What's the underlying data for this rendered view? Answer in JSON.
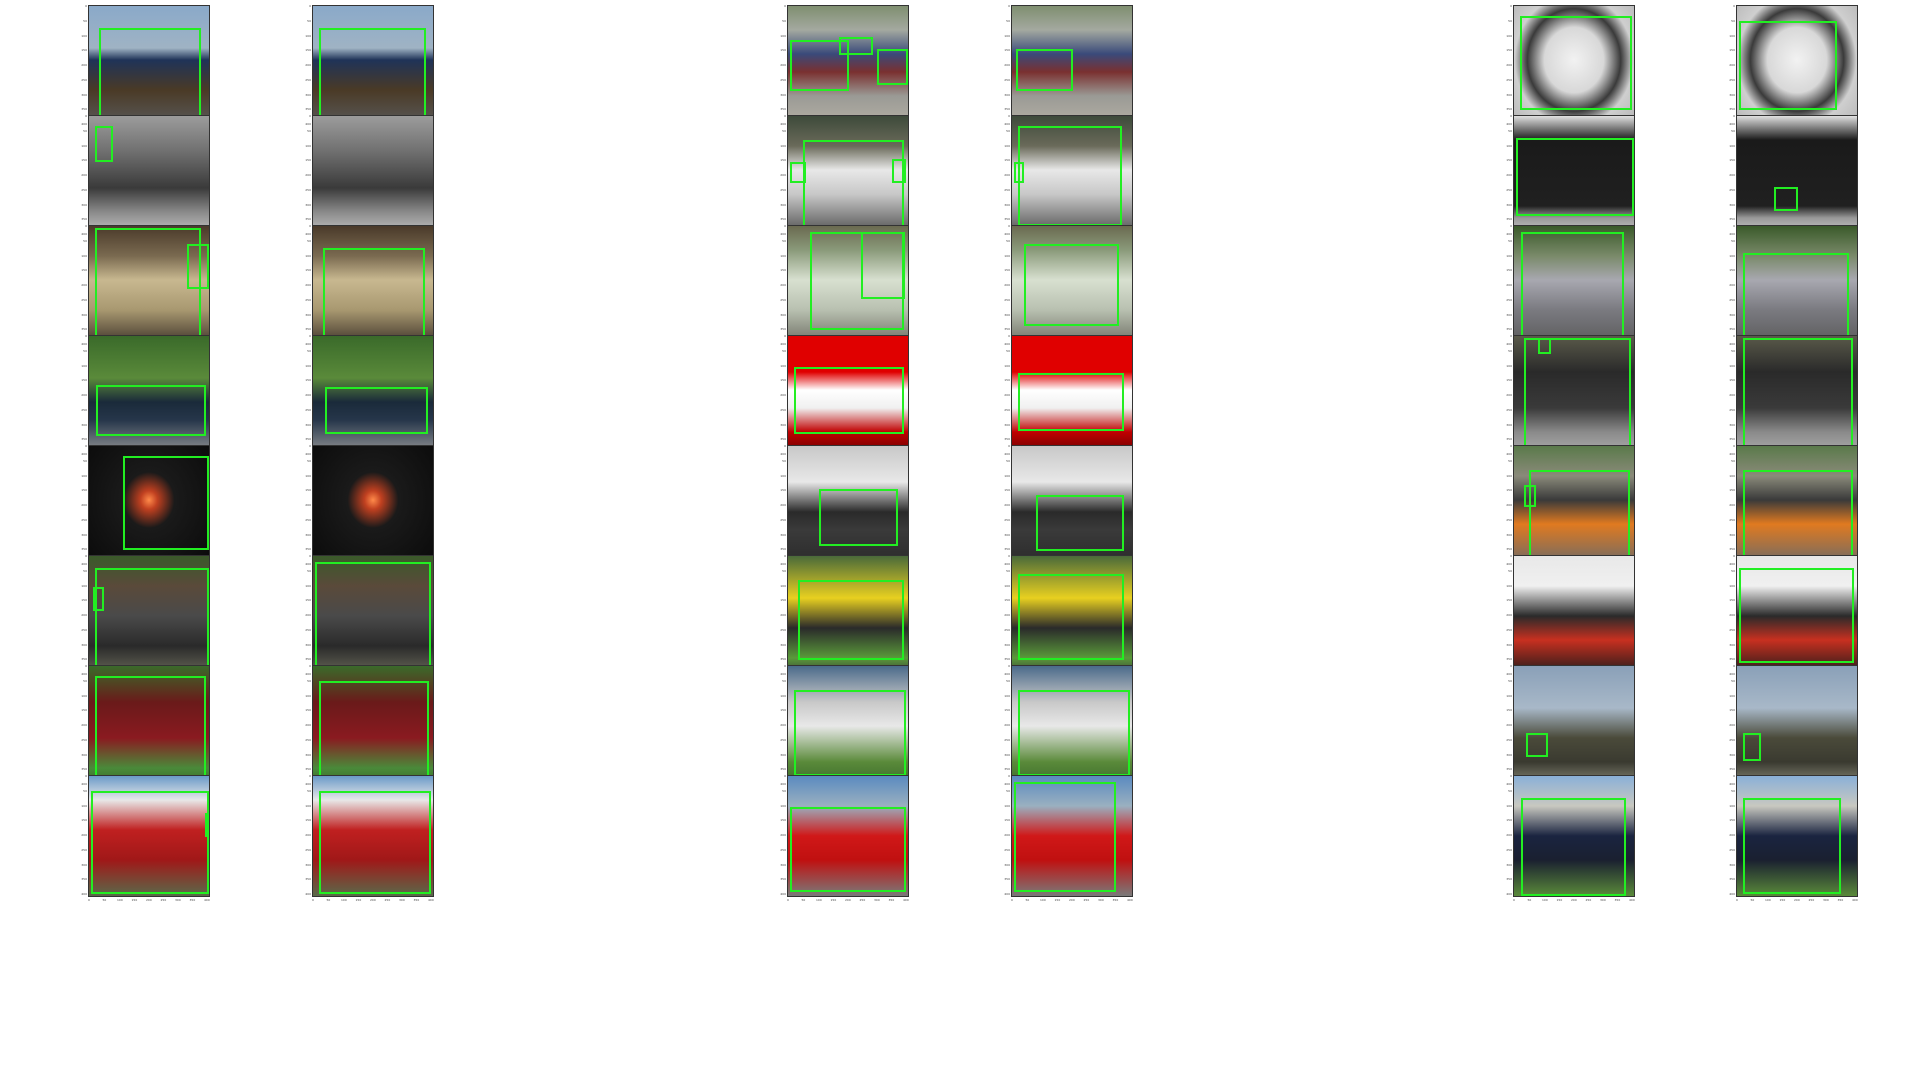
{
  "figure": {
    "axis_ticks": [
      "0",
      "50",
      "100",
      "150",
      "200",
      "250",
      "300",
      "350",
      "400"
    ],
    "columns": 6,
    "rows": 8,
    "panels": [
      {
        "bg": "linear-gradient(180deg,#8aa9c9 0%,#9fb3c4 35%,#1f3358 45%,#4a3a26 70%,#5a5a5a 100%)",
        "boxes": []
      },
      {
        "bg": "linear-gradient(180deg,#8aa9c9 0%,#9fb3c4 35%,#1f3358 45%,#4a3a26 70%,#5a5a5a 100%)",
        "boxes": []
      },
      {
        "bg": "linear-gradient(180deg,#7f8f70 0%,#a4a9a0 20%,#3a4a7a 40%,#7a3030 55%,#9a9a95 75%,#b5b0a5 100%)",
        "boxes": []
      },
      {
        "bg": "linear-gradient(180deg,#7f8f70 0%,#a4a9a0 20%,#3a4a7a 40%,#7a3030 55%,#9a9a95 75%,#b5b0a5 100%)",
        "boxes": []
      },
      {
        "bg": "radial-gradient(ellipse at 50% 45%,#f2f2f2 0%,#d8d8d8 35%,#3a3a3a 55%,#cfcfcf 70%,#b5b5b5 100%)",
        "boxes": []
      },
      {
        "bg": "radial-gradient(ellipse at 50% 45%,#f2f2f2 0%,#d8d8d8 35%,#3a3a3a 55%,#cfcfcf 70%,#b5b5b5 100%)",
        "boxes": []
      },
      {
        "bg": "linear-gradient(180deg,#9c9c9c 0%,#6f6f6f 30%,#3a3a3a 60%,#8a8a8a 80%,#c8c8c8 100%)",
        "boxes": []
      },
      {
        "bg": "linear-gradient(180deg,#9c9c9c 0%,#6f6f6f 30%,#3a3a3a 60%,#8a8a8a 80%,#c8c8c8 100%)",
        "boxes": []
      },
      {
        "bg": "linear-gradient(180deg,#3d4a3a 0%,#6a6a5a 25%,#e8e8e8 45%,#c8c8c8 65%,#4a4a4a 100%)",
        "boxes": []
      },
      {
        "bg": "linear-gradient(180deg,#3d4a3a 0%,#6a6a5a 25%,#e8e8e8 45%,#c8c8c8 65%,#4a4a4a 100%)",
        "boxes": []
      },
      {
        "bg": "linear-gradient(180deg,#e0e0e0 0%,#1a1a1a 20%,#202020 75%,#9a9a9a 85%,#d0d0d0 100%)",
        "boxes": []
      },
      {
        "bg": "linear-gradient(180deg,#e0e0e0 0%,#1a1a1a 20%,#202020 75%,#9a9a9a 85%,#d0d0d0 100%)",
        "boxes": []
      },
      {
        "bg": "linear-gradient(180deg,#4a3a2a 0%,#7a6a50 25%,#c8b890 45%,#a89870 70%,#3a3028 100%)",
        "boxes": []
      },
      {
        "bg": "linear-gradient(180deg,#4a3a2a 0%,#7a6a50 25%,#c8b890 45%,#a89870 70%,#3a3028 100%)",
        "boxes": []
      },
      {
        "bg": "linear-gradient(180deg,#6a6a50 0%,#8a9a7a 20%,#d8e0d0 45%,#b8c0b0 70%,#6a6a60 100%)",
        "boxes": []
      },
      {
        "bg": "linear-gradient(180deg,#6a6a50 0%,#8a9a7a 20%,#d8e0d0 45%,#b8c0b0 70%,#6a6a60 100%)",
        "boxes": []
      },
      {
        "bg": "linear-gradient(180deg,#3a5a2a 0%,#7a8a6a 25%,#a8a8b0 45%,#7a7a80 70%,#5a5a5a 100%)",
        "boxes": []
      },
      {
        "bg": "linear-gradient(180deg,#3a5a2a 0%,#7a8a6a 25%,#a8a8b0 45%,#7a7a80 70%,#5a5a5a 100%)",
        "boxes": []
      },
      {
        "bg": "linear-gradient(180deg,#3a6a2a 0%,#5a8a3a 35%,#1a2a3a 55%,#26364a 70%,#9a9a9a 100%)",
        "boxes": []
      },
      {
        "bg": "linear-gradient(180deg,#3a6a2a 0%,#5a8a3a 35%,#1a2a3a 55%,#26364a 70%,#9a9a9a 100%)",
        "boxes": []
      },
      {
        "bg": "linear-gradient(180deg,#e00000 0%,#e00000 30%,#ffffff 45%,#f0f0f0 60%,#c00000 80%,#600000 100%)",
        "boxes": []
      },
      {
        "bg": "linear-gradient(180deg,#e00000 0%,#e00000 30%,#ffffff 45%,#f0f0f0 60%,#c00000 80%,#600000 100%)",
        "boxes": []
      },
      {
        "bg": "linear-gradient(180deg,#5a5a4a 0%,#2a2a2a 30%,#3a3a3a 60%,#8a8a8a 80%,#b0b0b0 100%)",
        "boxes": []
      },
      {
        "bg": "linear-gradient(180deg,#5a5a4a 0%,#2a2a2a 30%,#3a3a3a 60%,#8a8a8a 80%,#b0b0b0 100%)",
        "boxes": []
      },
      {
        "bg": "radial-gradient(ellipse at 50% 45%,#ff8a4a 0%,#c04020 10%,#1a1a1a 30%,#0a0a0a 100%)",
        "boxes": []
      },
      {
        "bg": "radial-gradient(ellipse at 50% 45%,#ff8a4a 0%,#c04020 10%,#1a1a1a 30%,#0a0a0a 100%)",
        "boxes": []
      },
      {
        "bg": "linear-gradient(180deg,#c8c8c8 0%,#e8e8e8 30%,#2a2a2a 55%,#3a3a3a 70%,#2a2a2a 100%)",
        "boxes": []
      },
      {
        "bg": "linear-gradient(180deg,#c8c8c8 0%,#e8e8e8 30%,#2a2a2a 55%,#3a3a3a 70%,#2a2a2a 100%)",
        "boxes": []
      },
      {
        "bg": "linear-gradient(180deg,#5a7a4a 0%,#8a8a7a 25%,#3a3a3a 45%,#e07a20 65%,#6a6a6a 100%)",
        "boxes": []
      },
      {
        "bg": "linear-gradient(180deg,#5a7a4a 0%,#8a8a7a 25%,#3a3a3a 45%,#e07a20 65%,#6a6a6a 100%)",
        "boxes": []
      },
      {
        "bg": "linear-gradient(180deg,#3a5a2a 0%,#5a4a3a 25%,#4a4a4a 50%,#2a2a2a 75%,#6a6a5a 100%)",
        "boxes": []
      },
      {
        "bg": "linear-gradient(180deg,#3a5a2a 0%,#5a4a3a 25%,#4a4a4a 50%,#2a2a2a 75%,#6a6a5a 100%)",
        "boxes": []
      },
      {
        "bg": "linear-gradient(180deg,#4a6a3a 0%,#e8d020 35%,#2a2a2a 60%,#5a9a3a 85%,#3a3a3a 100%)",
        "boxes": []
      },
      {
        "bg": "linear-gradient(180deg,#4a6a3a 0%,#e8d020 35%,#2a2a2a 60%,#5a9a3a 85%,#3a3a3a 100%)",
        "boxes": []
      },
      {
        "bg": "linear-gradient(180deg,#e8e8e8 0%,#f0f0f0 25%,#2a2a2a 50%,#c83020 70%,#1a1a1a 100%)",
        "boxes": []
      },
      {
        "bg": "linear-gradient(180deg,#e8e8e8 0%,#f0f0f0 25%,#2a2a2a 50%,#c83020 70%,#1a1a1a 100%)",
        "boxes": []
      },
      {
        "bg": "linear-gradient(180deg,#3a6a2a 0%,#6a1a1a 30%,#8a1a20 60%,#4a8a3a 85%,#3a6a2a 100%)",
        "boxes": []
      },
      {
        "bg": "linear-gradient(180deg,#3a6a2a 0%,#6a1a1a 30%,#8a1a20 60%,#4a8a3a 85%,#3a6a2a 100%)",
        "boxes": []
      },
      {
        "bg": "linear-gradient(180deg,#4a6a8a 0%,#c8c8c8 30%,#e8e8e8 50%,#5a8a3a 80%,#3a6a2a 100%)",
        "boxes": []
      },
      {
        "bg": "linear-gradient(180deg,#4a6a8a 0%,#c8c8c8 30%,#e8e8e8 50%,#5a8a3a 80%,#3a6a2a 100%)",
        "boxes": []
      },
      {
        "bg": "linear-gradient(180deg,#8aa0b8 0%,#a8b8c8 35%,#4a4a3a 60%,#3a3a30 80%,#8a8a7a 100%)",
        "boxes": []
      },
      {
        "bg": "linear-gradient(180deg,#8aa0b8 0%,#a8b8c8 35%,#4a4a3a 60%,#3a3a30 80%,#8a8a7a 100%)",
        "boxes": []
      },
      {
        "bg": "linear-gradient(180deg,#6a9ac8 0%,#e8e8e8 20%,#c02020 45%,#a01818 70%,#5a6a4a 100%)",
        "boxes": []
      },
      {
        "bg": "linear-gradient(180deg,#6a9ac8 0%,#e8e8e8 20%,#c02020 45%,#a01818 70%,#5a6a4a 100%)",
        "boxes": []
      },
      {
        "bg": "linear-gradient(180deg,#5a8ac0 0%,#9ab0c0 25%,#d01818 50%,#c01010 70%,#7a7a7a 100%)",
        "boxes": []
      },
      {
        "bg": "linear-gradient(180deg,#5a8ac0 0%,#9ab0c0 25%,#d01818 50%,#c01010 70%,#7a7a7a 100%)",
        "boxes": []
      },
      {
        "bg": "linear-gradient(180deg,#8ab0d8 0%,#c8c8c0 25%,#1a2440 50%,#1a2030 70%,#5a8a3a 100%)",
        "boxes": []
      },
      {
        "bg": "linear-gradient(180deg,#8ab0d8 0%,#c8c8c0 25%,#1a2440 50%,#1a2030 70%,#5a8a3a 100%)",
        "boxes": []
      }
    ]
  }
}
